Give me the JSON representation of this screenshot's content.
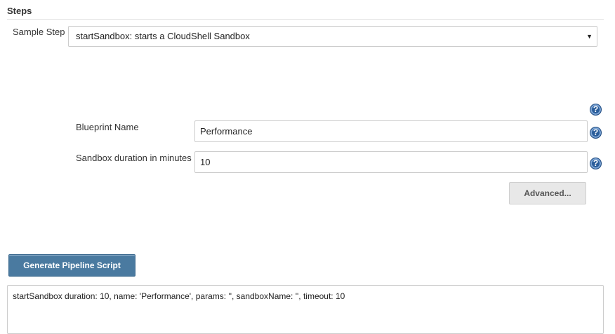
{
  "section": {
    "title": "Steps"
  },
  "sample_step": {
    "label": "Sample Step",
    "selected": "startSandbox: starts a CloudShell Sandbox",
    "caret": "▼"
  },
  "help": {
    "glyph": "?"
  },
  "blueprint": {
    "label": "Blueprint Name",
    "value": "Performance"
  },
  "duration": {
    "label": "Sandbox duration in minutes",
    "value": "10"
  },
  "advanced_button": {
    "label": "Advanced..."
  },
  "generate_button": {
    "label": "Generate Pipeline Script"
  },
  "output": {
    "script": "startSandbox duration: 10, name: 'Performance', params: '', sandboxName: '', timeout: 10"
  },
  "colors": {
    "help_icon": "#2a5d9a",
    "generate_button": "#4a7aa0",
    "advanced_button": "#e8e8e8"
  },
  "icons": [
    "help-icon",
    "chevron-down-icon"
  ]
}
